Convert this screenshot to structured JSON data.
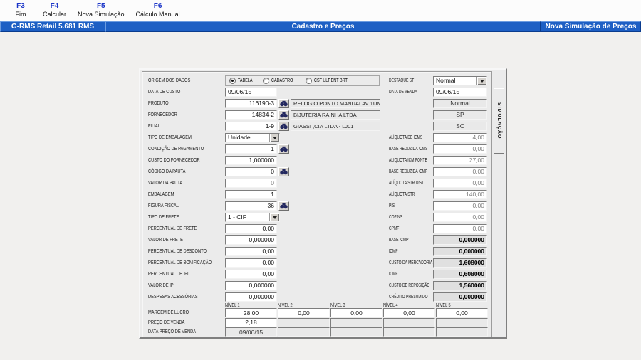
{
  "colors": {
    "titlebar_blue": "#1d5fc4",
    "panel_bg": "#ebebeb"
  },
  "fkeys": [
    {
      "key": "F3",
      "label": "Fim"
    },
    {
      "key": "F4",
      "label": "Calcular"
    },
    {
      "key": "F5",
      "label": "Nova Simulação"
    },
    {
      "key": "F6",
      "label": "Cálculo Manual"
    }
  ],
  "titlebar": {
    "app": "G-RMS Retail 5.681 RMS",
    "center": "Cadastro e Preços",
    "right": "Nova Simulação de Preços"
  },
  "tab_label": "SIMULAÇÃO",
  "origem": {
    "label": "ORIGEM DOS DADOS",
    "options": [
      "TABELA",
      "CADASTRO",
      "CST ULT ENT BRT"
    ],
    "selected": "TABELA"
  },
  "left": {
    "data_custo": {
      "label": "DATA DE CUSTO",
      "value": "09/06/15"
    },
    "produto": {
      "label": "PRODUTO",
      "code": "116190-3",
      "desc": "RELOGIO PONTO MANUAL",
      "extra": "AV  1UN"
    },
    "fornecedor": {
      "label": "FORNECEDOR",
      "code": "14834-2",
      "desc": "BIJUTERIA RAINHA LTDA"
    },
    "filial": {
      "label": "FILIAL",
      "code": "1-9",
      "desc": "GIASSI ,CIA LTDA - LJ01"
    },
    "tipo_embalagem": {
      "label": "TIPO DE EMBALAGEM",
      "value": "Unidade"
    },
    "condicao_pagamento": {
      "label": "CONDIÇÃO DE PAGAMENTO",
      "value": "1"
    },
    "custo_fornecedor": {
      "label": "CUSTO DO FORNECEDOR",
      "value": "1,000000"
    },
    "codigo_pauta": {
      "label": "CÓDIGO DA PAUTA",
      "value": "0"
    },
    "valor_pauta": {
      "label": "VALOR DA PAUTA",
      "value": "0"
    },
    "embalagem": {
      "label": "EMBALAGEM",
      "value": "1"
    },
    "figura_fiscal": {
      "label": "FIGURA FISCAL",
      "value": "36"
    },
    "tipo_frete": {
      "label": "TIPO DE FRETE",
      "value": "1 - CIF"
    },
    "perc_frete": {
      "label": "PERCENTUAL DE FRETE",
      "value": "0,00"
    },
    "valor_frete": {
      "label": "VALOR DE FRETE",
      "value": "0,000000"
    },
    "perc_desconto": {
      "label": "PERCENTUAL DE DESCONTO",
      "value": "0,00"
    },
    "perc_bonificacao": {
      "label": "PERCENTUAL DE BONIFICAÇÃO",
      "value": "0,00"
    },
    "perc_ipi": {
      "label": "PERCENTUAL DE IPI",
      "value": "0,00"
    },
    "valor_ipi": {
      "label": "VALOR DE IPI",
      "value": "0,000000"
    },
    "despesas": {
      "label": "DESPESAS ACESSÓRIAS",
      "value": "0,000000"
    }
  },
  "right_top": {
    "destaque_st": {
      "label": "DESTAQUE ST",
      "value": "Normal"
    },
    "data_venda": {
      "label": "DATA DE VENDA",
      "value": "09/06/15"
    },
    "produto_status": "Normal",
    "fornecedor_uf": "SP",
    "filial_uf": "SC"
  },
  "right_fields": [
    {
      "label": "ALÍQUOTA DE ICMS",
      "value": "4,00",
      "bold": false
    },
    {
      "label": "BASE REDUZIDA ICMS",
      "value": "0,00",
      "bold": false
    },
    {
      "label": "ALIQUOTA ICM FONTE",
      "value": "27,00",
      "bold": false
    },
    {
      "label": "BASE REDUZIDA ICMF",
      "value": "0,00",
      "bold": false
    },
    {
      "label": "ALÍQUOTA STR DIST",
      "value": "0,00",
      "bold": false
    },
    {
      "label": "ALÍQUOTA STR",
      "value": "140,00",
      "bold": false
    },
    {
      "label": "PIS",
      "value": "0,00",
      "bold": false
    },
    {
      "label": "COFINS",
      "value": "0,00",
      "bold": false
    },
    {
      "label": "CPMF",
      "value": "0,00",
      "bold": false
    },
    {
      "label": "BASE ICMP",
      "value": "0,000000",
      "bold": true
    },
    {
      "label": "ICMP",
      "value": "0,000000",
      "bold": true
    },
    {
      "label": "CUSTO DA MERCADORIA",
      "value": "1,608000",
      "bold": true
    },
    {
      "label": "ICMF",
      "value": "0,608000",
      "bold": true
    },
    {
      "label": "CUSTO DE REPOSIÇÃO",
      "value": "1,560000",
      "bold": true
    },
    {
      "label": "CRÉDITO PRESUMIDO",
      "value": "0,000000",
      "bold": true
    }
  ],
  "niveis": {
    "headers": [
      "NÍVEL 1",
      "NÍVEL 2",
      "NÍVEL 3",
      "NÍVEL 4",
      "NÍVEL 5"
    ],
    "rows": [
      {
        "label": "MARGEM DE LUCRO",
        "values": [
          "28,00",
          "0,00",
          "0,00",
          "0,00",
          "0,00"
        ]
      },
      {
        "label": "PREÇO DE VENDA",
        "values": [
          "2,18",
          "",
          "",
          "",
          ""
        ]
      },
      {
        "label": "DATA PREÇO DE VENDA",
        "values": [
          "09/06/15",
          "",
          "",
          "",
          ""
        ]
      }
    ]
  }
}
